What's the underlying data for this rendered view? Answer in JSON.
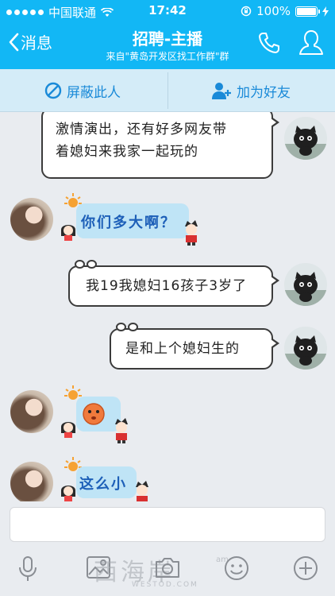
{
  "status_bar": {
    "carrier": "中国联通",
    "time": "17:42",
    "battery": "100%"
  },
  "nav": {
    "back_label": "消息",
    "title": "招聘-主播",
    "subtitle": "来自\"黄岛开发区找工作群\"群"
  },
  "actions": {
    "block_label": "屏蔽此人",
    "add_friend_label": "加为好友"
  },
  "messages": [
    {
      "side": "right",
      "lines": [
        "激情演出，还有好多网友带",
        "着媳妇来我家一起玩的"
      ]
    },
    {
      "side": "left",
      "text": "你们多大啊？"
    },
    {
      "side": "right",
      "text": "我19我媳妇16孩子3岁了"
    },
    {
      "side": "right",
      "text": "是和上个媳妇生的"
    },
    {
      "side": "left",
      "sticker": "face"
    },
    {
      "side": "left",
      "text": "这么小"
    }
  ],
  "watermark": {
    "text": "西海岸",
    "sub": "WESTOD.COM",
    "tag": "am"
  },
  "colors": {
    "nav_bg": "#12b7f5",
    "action_bg": "#d4ecf8",
    "action_text": "#1a8ad8",
    "sticker_bubble": "#bfe4f6"
  }
}
